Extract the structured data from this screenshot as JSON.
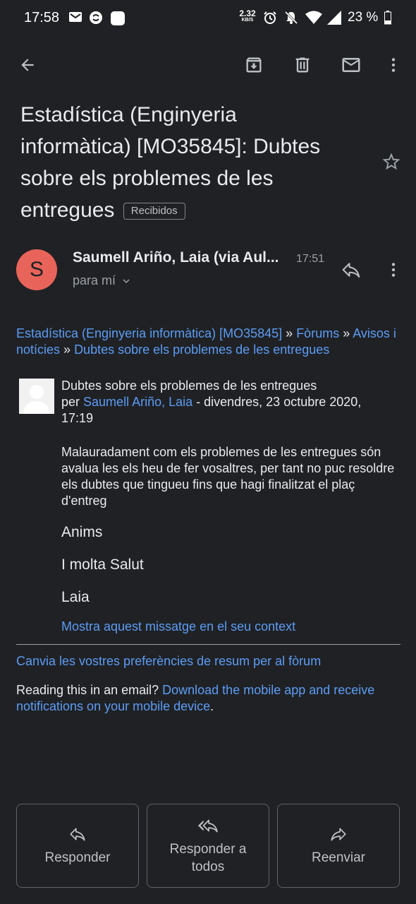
{
  "status_bar": {
    "time": "17:58",
    "net_speed_value": "2.32",
    "net_speed_unit": "KB/S",
    "battery": "23 %"
  },
  "toolbar": {
    "back_icon": "arrow-back-icon",
    "archive_icon": "archive-icon",
    "delete_icon": "trash-icon",
    "mark_unread_icon": "mail-icon",
    "more_icon": "more-vert-icon"
  },
  "email": {
    "subject": "Estadística (Enginyeria informàtica) [MO35845]: Dubtes sobre els problemes de les entregues",
    "label": "Recibidos",
    "sender_initial": "S",
    "sender_name": "Saumell Ariño, Laia (via Aul...",
    "time": "17:51",
    "to": "para mí"
  },
  "body": {
    "breadcrumb_course": "Estadística (Enginyeria informàtica) [MO35845]",
    "breadcrumb_sep1": " » ",
    "breadcrumb_forums": "Fòrums",
    "breadcrumb_sep2": " » ",
    "breadcrumb_forum": "Avisos i notícies",
    "breadcrumb_sep3": " » ",
    "breadcrumb_topic": "Dubtes sobre els problemes de les entregues",
    "post_title": "Dubtes sobre els problemes de les entregues",
    "post_by": "per ",
    "post_author": "Saumell Ariño, Laia",
    "post_date": " - divendres, 23 octubre 2020, 17:19",
    "message": "Malauradament com els problemes de les entregues són avalua les els heu de fer vosaltres, per tant no puc resoldre els dubtes que tingueu fins que hagi finalitzat el plaç d'entreg",
    "sign1": "Anims",
    "sign2": "I molta Salut",
    "sign3": "Laia",
    "context_link": "Mostra aquest missatge en el seu context",
    "prefs_link": "Canvia les vostres preferències de resum per al fòrum",
    "reading_prefix": "Reading this in an email? ",
    "reading_link": "Download the mobile app and receive notifications on your mobile device",
    "reading_suffix": "."
  },
  "actions": {
    "reply": "Responder",
    "reply_all": "Responder a todos",
    "forward": "Reenviar"
  },
  "colors": {
    "background": "#202124",
    "link": "#5b9cf5",
    "avatar": "#e8645a"
  }
}
